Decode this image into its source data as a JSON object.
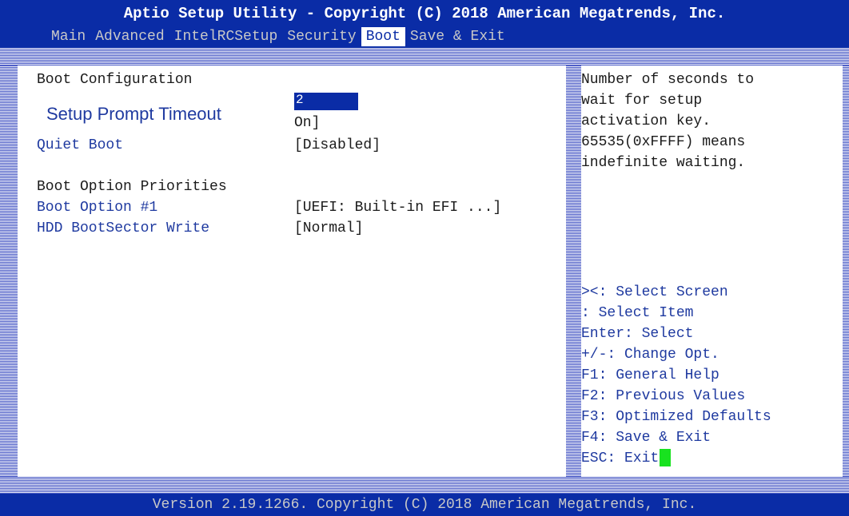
{
  "title": "Aptio Setup Utility - Copyright (C) 2018 American Megatrends, Inc.",
  "menu": [
    {
      "label": "Main"
    },
    {
      "label": "Advanced"
    },
    {
      "label": "IntelRCSetup"
    },
    {
      "label": "Security"
    },
    {
      "label": "Boot",
      "active": true
    },
    {
      "label": "Save & Exit"
    }
  ],
  "left": {
    "section_boot_config": "Boot Configuration",
    "setup_prompt_timeout_label": "Setup Prompt Timeout",
    "setup_prompt_timeout_value": "2",
    "setup_prompt_timeout_suffix": "On]",
    "quiet_boot_label": "Quiet Boot",
    "quiet_boot_value": "[Disabled]",
    "section_boot_priorities": "Boot Option Priorities",
    "boot_option1_label": "Boot Option #1",
    "boot_option1_value": "[UEFI: Built-in EFI ...]",
    "hdd_bootsector_label": "HDD BootSector Write",
    "hdd_bootsector_value": "[Normal]"
  },
  "help": [
    "Number of seconds to",
    "wait for setup",
    "activation key.",
    "65535(0xFFFF) means",
    "indefinite waiting."
  ],
  "keys": [
    "><: Select Screen",
    ": Select Item",
    "Enter: Select",
    "+/-: Change Opt.",
    "F1: General Help",
    "F2: Previous Values",
    "F3: Optimized Defaults",
    "F4: Save & Exit",
    "ESC: Exit"
  ],
  "footer": "Version 2.19.1266. Copyright (C) 2018 American Megatrends, Inc.",
  "colors": {
    "bar_blue": "#0a2ca6",
    "text_blue": "#1f3aa0",
    "cursor_green": "#18e21f"
  }
}
